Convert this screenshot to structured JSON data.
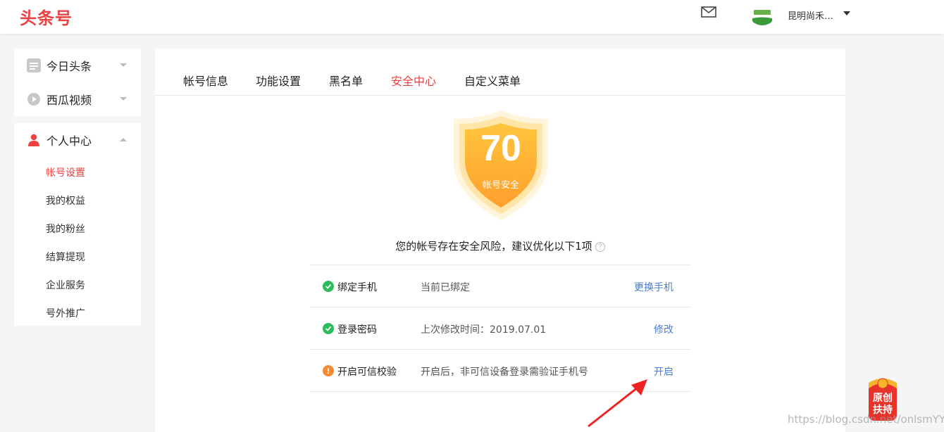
{
  "brand": {
    "logo": "头条号"
  },
  "header": {
    "username": "昆明尚禾…",
    "mail_icon": "mail-icon",
    "avatar_icon": "avatar-logo"
  },
  "sidebar": {
    "groups": [
      {
        "label": "今日头条",
        "icon": "toutiao-icon"
      },
      {
        "label": "西瓜视频",
        "icon": "play-icon"
      },
      {
        "label": "个人中心",
        "icon": "person-icon"
      }
    ],
    "sub_items": [
      "帐号设置",
      "我的权益",
      "我的粉丝",
      "结算提现",
      "企业服务",
      "号外推广"
    ]
  },
  "tabs": [
    "帐号信息",
    "功能设置",
    "黑名单",
    "安全中心",
    "自定义菜单"
  ],
  "security": {
    "score": "70",
    "score_label": "帐号安全",
    "warning": "您的帐号存在安全风险，建议优化以下1项",
    "help_glyph": "?",
    "rows": [
      {
        "name": "绑定手机",
        "desc": "当前已绑定",
        "action": "更换手机",
        "status": "ok"
      },
      {
        "name": "登录密码",
        "desc": "上次修改时间：2019.07.01",
        "action": "修改",
        "status": "ok"
      },
      {
        "name": "开启可信校验",
        "desc": "开启后，非可信设备登录需验证手机号",
        "action": "开启",
        "status": "warn"
      }
    ]
  },
  "badge": {
    "line1": "原创",
    "line2": "扶持"
  },
  "watermark": "https://blog.csdn.net/onlsmYY",
  "colors": {
    "accent": "#ed4040",
    "link": "#4a7ed2",
    "ok": "#2dbb5b",
    "warn": "#f58a2e",
    "shield": "#ffb52f"
  }
}
